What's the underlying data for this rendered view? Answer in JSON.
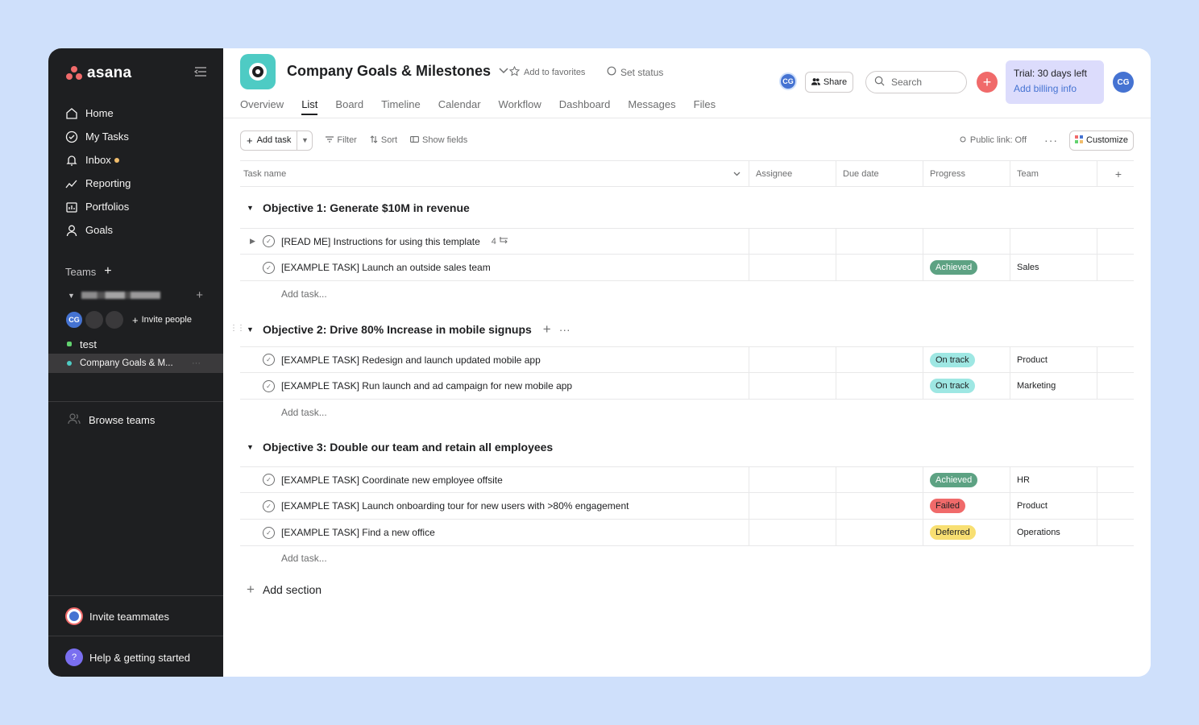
{
  "brand": {
    "name": "asana",
    "accent": "#f06a6a"
  },
  "sidebar": {
    "nav": [
      {
        "label": "Home",
        "icon": "home-icon"
      },
      {
        "label": "My Tasks",
        "icon": "check-circle-icon"
      },
      {
        "label": "Inbox",
        "icon": "bell-icon"
      },
      {
        "label": "Reporting",
        "icon": "chart-line-icon"
      },
      {
        "label": "Portfolios",
        "icon": "folder-icon"
      },
      {
        "label": "Goals",
        "icon": "person-icon"
      }
    ],
    "teams_label": "Teams",
    "member_initials": "CG",
    "invite_people": "Invite people",
    "projects": [
      {
        "label": "test",
        "color": "#62d26f"
      },
      {
        "label": "Company Goals & M...",
        "color": "#4ecbc4"
      }
    ],
    "browse_teams": "Browse teams",
    "invite_teammates": "Invite teammates",
    "help": "Help & getting started"
  },
  "header": {
    "title": "Company Goals & Milestones",
    "add_to_favorites": "Add to favorites",
    "set_status": "Set status",
    "tabs": [
      "Overview",
      "List",
      "Board",
      "Timeline",
      "Calendar",
      "Workflow",
      "Dashboard",
      "Messages",
      "Files"
    ],
    "active_tab": "List",
    "avatar_initials": "CG",
    "share": "Share",
    "search_placeholder": "Search",
    "trial_title": "Trial: 30 days left",
    "trial_link": "Add billing info",
    "me_initials": "CG"
  },
  "toolbar": {
    "add_task": "Add task",
    "filter": "Filter",
    "sort": "Sort",
    "show_fields": "Show fields",
    "public_link": "Public link: Off",
    "more": "···",
    "customize": "Customize"
  },
  "table": {
    "columns": [
      "Task name",
      "Assignee",
      "Due date",
      "Progress",
      "Team"
    ],
    "add_column": "+",
    "add_task_row": "Add task...",
    "add_section": "Add section",
    "sections": [
      {
        "title": "Objective 1: Generate $10M in revenue",
        "tasks": [
          {
            "name": "[READ ME] Instructions for using this template",
            "subtasks": "4",
            "progress": "",
            "team": ""
          },
          {
            "name": "[EXAMPLE TASK] Launch an outside sales team",
            "progress": "Achieved",
            "team": "Sales"
          }
        ]
      },
      {
        "title": "Objective 2: Drive 80% Increase in mobile signups",
        "tasks": [
          {
            "name": "[EXAMPLE TASK] Redesign and launch updated mobile app",
            "progress": "On track",
            "team": "Product"
          },
          {
            "name": "[EXAMPLE TASK] Run launch and ad campaign for new mobile app",
            "progress": "On track",
            "team": "Marketing"
          }
        ]
      },
      {
        "title": "Objective 3: Double our team and retain all employees",
        "tasks": [
          {
            "name": "[EXAMPLE TASK] Coordinate new employee offsite",
            "progress": "Achieved",
            "team": "HR"
          },
          {
            "name": "[EXAMPLE TASK] Launch onboarding tour for new users with >80% engagement",
            "progress": "Failed",
            "team": "Product"
          },
          {
            "name": "[EXAMPLE TASK] Find a new office",
            "progress": "Deferred",
            "team": "Operations"
          }
        ]
      }
    ]
  },
  "status_colors": {
    "Achieved": {
      "bg": "#5da283",
      "fg": "#ffffff"
    },
    "On track": {
      "bg": "#9ee7e3",
      "fg": "#1e1f21"
    },
    "Failed": {
      "bg": "#f06a6a",
      "fg": "#1e1f21"
    },
    "Deferred": {
      "bg": "#f8df72",
      "fg": "#1e1f21"
    }
  }
}
